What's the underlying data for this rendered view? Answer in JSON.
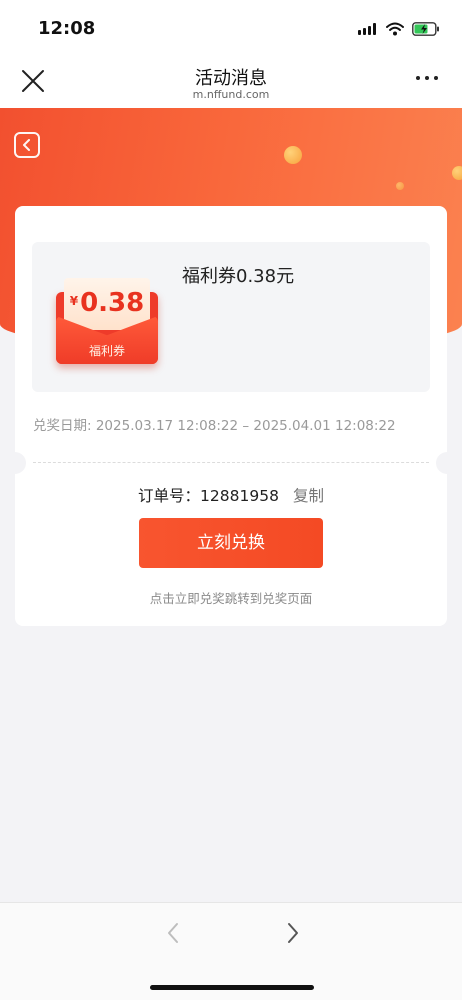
{
  "status_bar": {
    "time": "12:08",
    "signal_icon": "signal-icon",
    "wifi_icon": "wifi-icon",
    "battery_icon": "battery-charging-icon"
  },
  "nav": {
    "title": "活动消息",
    "subtitle": "m.nffund.com",
    "close_icon": "close-icon",
    "more_icon": "more-icon"
  },
  "banner": {
    "back_icon": "back-icon"
  },
  "coupon": {
    "currency": "¥",
    "amount": "0.38",
    "tag": "福利券",
    "title": "福利券0.38元",
    "redeem_date": "兑奖日期: 2025.03.17 12:08:22 – 2025.04.01 12:08:22"
  },
  "order": {
    "label": "订单号：",
    "number": "12881958",
    "copy_label": "复制"
  },
  "actions": {
    "redeem_label": "立刻兑换",
    "hint": "点击立即兑奖跳转到兑奖页面"
  },
  "toolbar": {
    "back_icon": "chevron-left-icon",
    "forward_icon": "chevron-right-icon"
  },
  "colors": {
    "accent": "#f44a24",
    "banner": "#f9673b",
    "page_bg": "#f3f3f6"
  }
}
